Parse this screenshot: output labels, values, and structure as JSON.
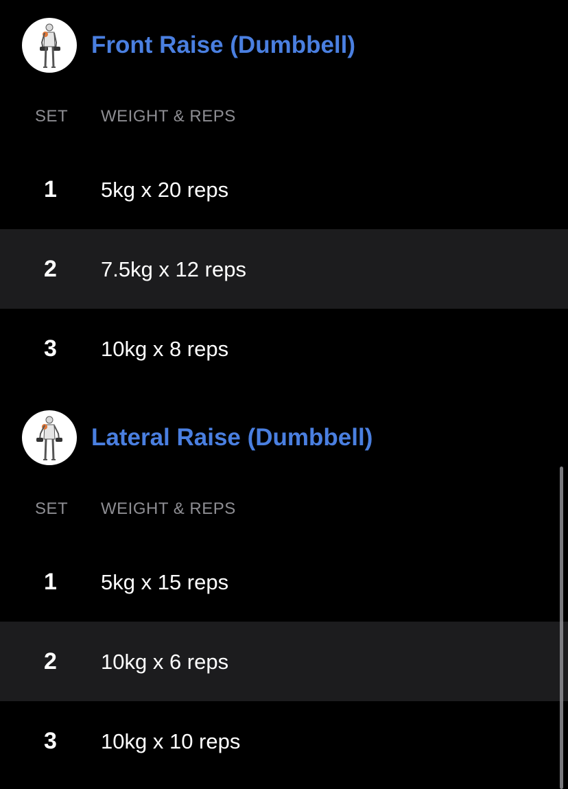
{
  "columns": {
    "set_label": "SET",
    "weight_reps_label": "WEIGHT & REPS"
  },
  "exercises": [
    {
      "title": "Front Raise (Dumbbell)",
      "icon": "front-raise-figure-icon",
      "sets": [
        {
          "number": "1",
          "value": "5kg x 20 reps"
        },
        {
          "number": "2",
          "value": "7.5kg x 12 reps"
        },
        {
          "number": "3",
          "value": "10kg x 8 reps"
        }
      ]
    },
    {
      "title": "Lateral Raise (Dumbbell)",
      "icon": "lateral-raise-figure-icon",
      "sets": [
        {
          "number": "1",
          "value": "5kg x 15 reps"
        },
        {
          "number": "2",
          "value": "10kg x 6 reps"
        },
        {
          "number": "3",
          "value": "10kg x 10 reps"
        }
      ]
    }
  ],
  "colors": {
    "background": "#000000",
    "title": "#4a7fe0",
    "header_text": "#8e8e93",
    "alt_row": "#1c1c1e"
  }
}
